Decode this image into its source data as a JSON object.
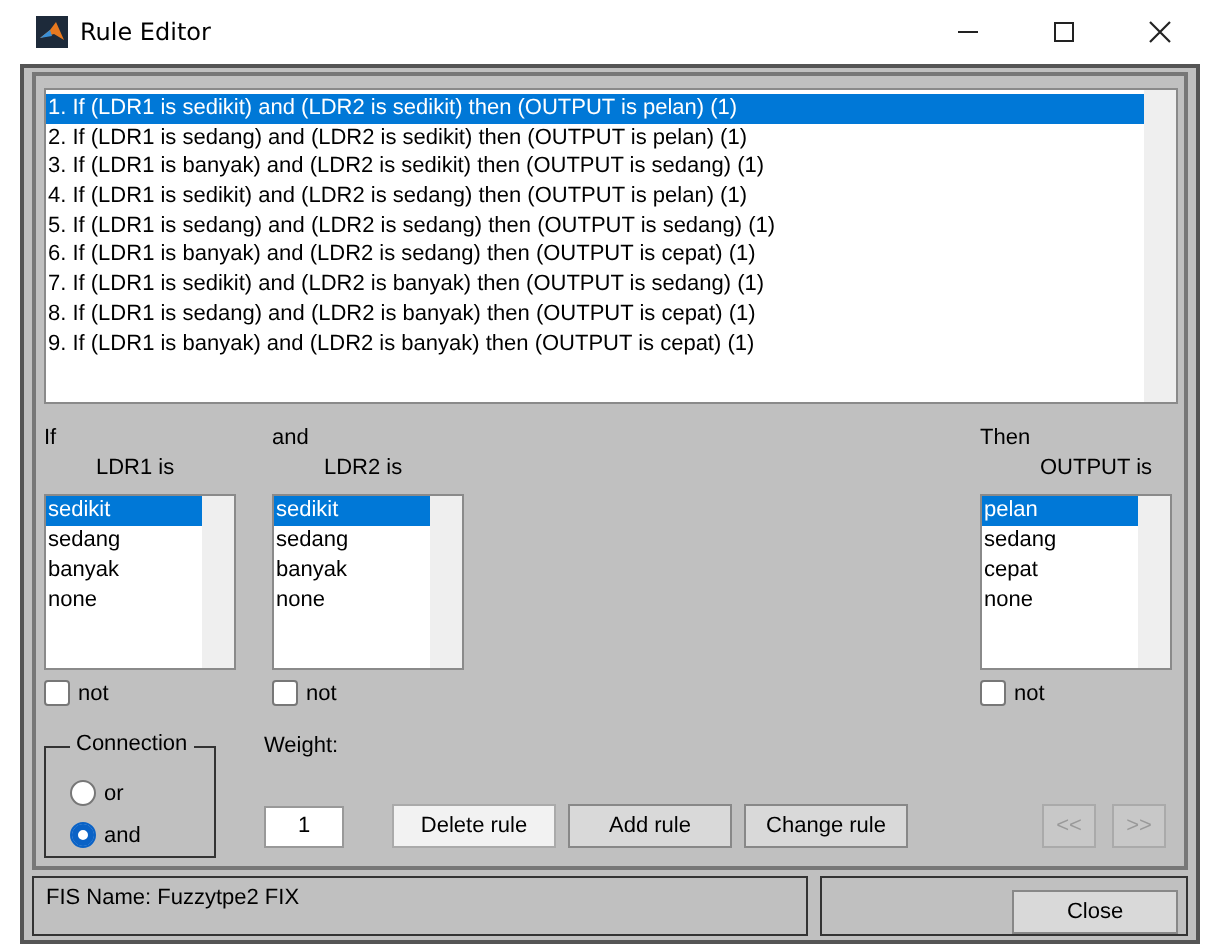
{
  "window": {
    "title": "Rule Editor"
  },
  "rules": [
    {
      "text": "1. If (LDR1 is sedikit) and (LDR2 is sedikit) then (OUTPUT is pelan) (1)",
      "selected": true
    },
    {
      "text": "2. If (LDR1 is sedang) and (LDR2 is sedikit) then (OUTPUT is pelan) (1)",
      "selected": false
    },
    {
      "text": "3. If (LDR1 is banyak) and (LDR2 is sedikit) then (OUTPUT is sedang) (1)",
      "selected": false
    },
    {
      "text": "4. If (LDR1 is sedikit) and (LDR2 is sedang) then (OUTPUT is pelan) (1)",
      "selected": false
    },
    {
      "text": "5. If (LDR1 is sedang) and (LDR2 is sedang) then (OUTPUT is sedang) (1)",
      "selected": false
    },
    {
      "text": "6. If (LDR1 is banyak) and (LDR2 is sedang) then (OUTPUT is cepat) (1)",
      "selected": false
    },
    {
      "text": "7. If (LDR1 is sedikit) and (LDR2 is banyak) then (OUTPUT is sedang) (1)",
      "selected": false
    },
    {
      "text": "8. If (LDR1 is sedang) and (LDR2 is banyak) then (OUTPUT is cepat) (1)",
      "selected": false
    },
    {
      "text": "9. If (LDR1 is banyak) and (LDR2 is banyak) then (OUTPUT is cepat) (1)",
      "selected": false
    }
  ],
  "variables": [
    {
      "prefix": "If",
      "label": "LDR1 is",
      "options": [
        {
          "label": "sedikit",
          "selected": true
        },
        {
          "label": "sedang",
          "selected": false
        },
        {
          "label": "banyak",
          "selected": false
        },
        {
          "label": "none",
          "selected": false
        }
      ],
      "not_label": "not",
      "not_checked": false
    },
    {
      "prefix": "and",
      "label": "LDR2 is",
      "options": [
        {
          "label": "sedikit",
          "selected": true
        },
        {
          "label": "sedang",
          "selected": false
        },
        {
          "label": "banyak",
          "selected": false
        },
        {
          "label": "none",
          "selected": false
        }
      ],
      "not_label": "not",
      "not_checked": false
    },
    {
      "prefix": "Then",
      "label": "OUTPUT is",
      "options": [
        {
          "label": "pelan",
          "selected": true
        },
        {
          "label": "sedang",
          "selected": false
        },
        {
          "label": "cepat",
          "selected": false
        },
        {
          "label": "none",
          "selected": false
        }
      ],
      "not_label": "not",
      "not_checked": false
    }
  ],
  "connection": {
    "title": "Connection",
    "options": [
      {
        "label": "or",
        "selected": false
      },
      {
        "label": "and",
        "selected": true
      }
    ]
  },
  "weight": {
    "label": "Weight:",
    "value": "1"
  },
  "buttons": [
    {
      "label": "Delete rule",
      "focused": true,
      "disabled": false
    },
    {
      "label": "Add rule",
      "focused": false,
      "disabled": false
    },
    {
      "label": "Change rule",
      "focused": false,
      "disabled": false
    }
  ],
  "nav_buttons": [
    {
      "label": "<<",
      "disabled": true
    },
    {
      "label": ">>",
      "disabled": true
    }
  ],
  "status_bar": {
    "text": "FIS Name: Fuzzytpe2 FIX",
    "close": "Close"
  }
}
